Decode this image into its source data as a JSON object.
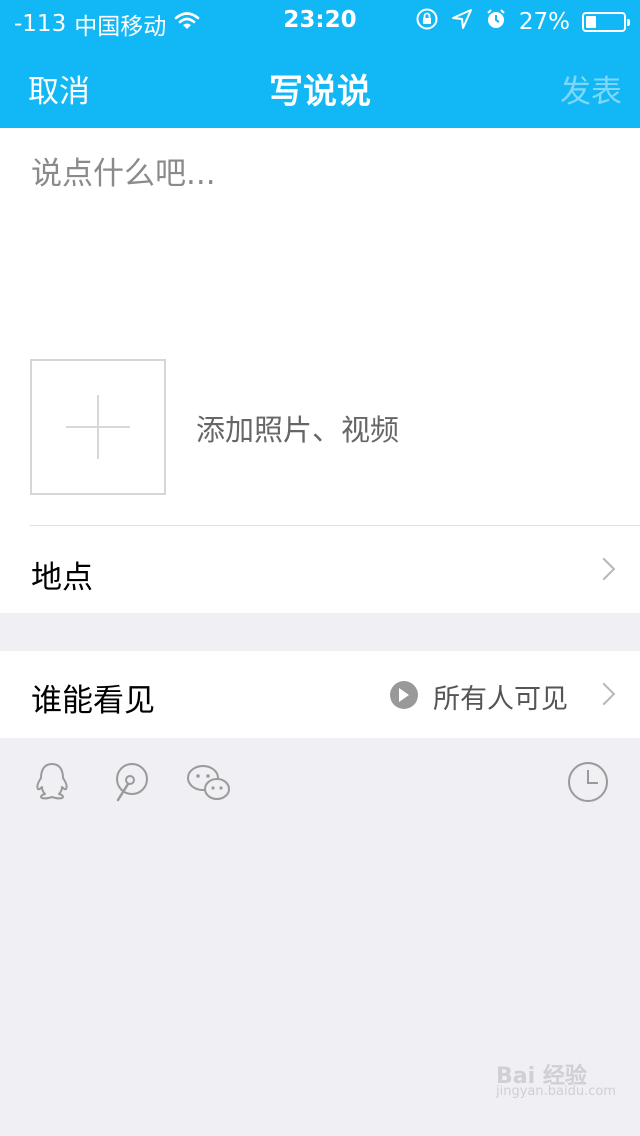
{
  "status_bar": {
    "signal": "-113",
    "carrier": "中国移动",
    "time": "23:20",
    "battery_percent_text": "27%",
    "battery_level": 0.27,
    "icons": [
      "wifi-icon",
      "rotation-lock-icon",
      "location-arrow-icon",
      "alarm-icon",
      "battery-icon"
    ]
  },
  "nav": {
    "cancel_label": "取消",
    "title": "写说说",
    "publish_label": "发表"
  },
  "compose": {
    "placeholder": "说点什么吧...",
    "add_media_label": "添加照片、视频"
  },
  "location": {
    "label": "地点"
  },
  "visibility": {
    "label": "谁能看见",
    "value": "所有人可见"
  },
  "share": {
    "icons": [
      "qq-icon",
      "weibo-icon",
      "wechat-icon",
      "clock-icon"
    ]
  },
  "watermark": {
    "line1": "Bai 经验",
    "line2": "jingyan.baidu.com"
  },
  "colors": {
    "accent": "#12b7f5",
    "publish_disabled": "#7fd7fa",
    "background": "#efeff4"
  }
}
